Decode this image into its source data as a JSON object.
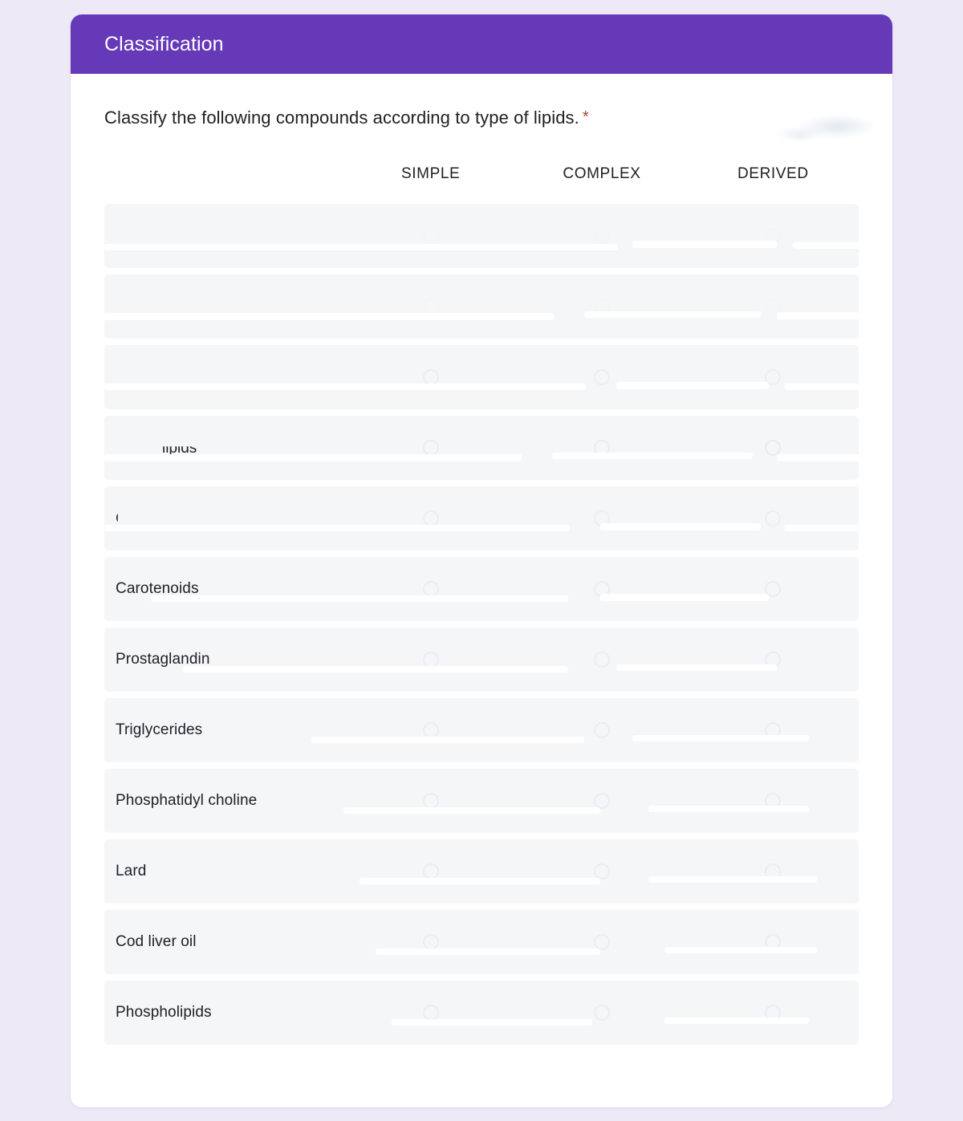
{
  "header": {
    "title": "Classification",
    "accent_color": "#6639b8"
  },
  "page": {
    "background_color": "#ede9f7",
    "card_background": "#ffffff",
    "row_background": "#f4f6f8",
    "required_marker_color": "#a9412f"
  },
  "question": {
    "text": "Classify the following compounds according to type of lipids.",
    "required_marker": "*"
  },
  "grid": {
    "columns": [
      "SIMPLE",
      "COMPLEX",
      "DERIVED"
    ],
    "rows": [
      {
        "label": "",
        "state": "erased-full",
        "fragment": ""
      },
      {
        "label": "",
        "state": "erased-full",
        "fragment": ""
      },
      {
        "label": "",
        "state": "erased-heavy",
        "fragment": ""
      },
      {
        "label": "",
        "state": "erased-mid",
        "fragment": "lipids"
      },
      {
        "label": "",
        "state": "erased-heavy",
        "fragment": "C"
      },
      {
        "label": "Carotenoids",
        "state": "radios-erased",
        "fragment": ""
      },
      {
        "label": "Prostaglandin",
        "state": "radios-erased",
        "fragment": ""
      },
      {
        "label": "Triglycerides",
        "state": "radios-erased",
        "fragment": ""
      },
      {
        "label": "Phosphatidyl choline",
        "state": "radios-erased",
        "fragment": ""
      },
      {
        "label": "Lard",
        "state": "radios-erased",
        "fragment": ""
      },
      {
        "label": "Cod liver oil",
        "state": "radios-erased",
        "fragment": ""
      },
      {
        "label": "Phospholipids",
        "state": "radios-erased",
        "fragment": ""
      }
    ]
  }
}
